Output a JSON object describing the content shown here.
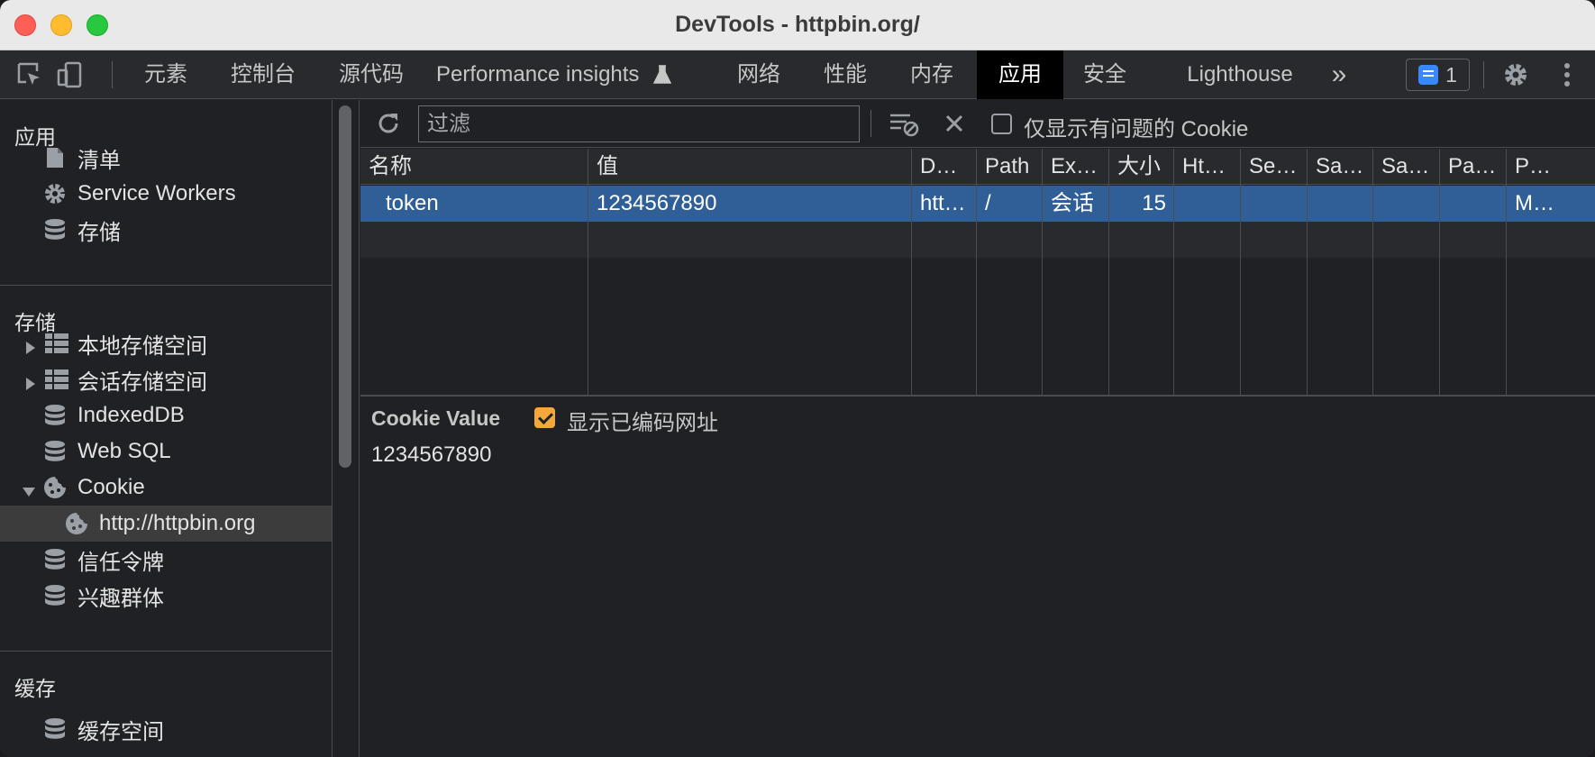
{
  "window": {
    "title": "DevTools - httpbin.org/"
  },
  "tabs": [
    {
      "label": "元素"
    },
    {
      "label": "控制台"
    },
    {
      "label": "源代码"
    },
    {
      "label": "Performance insights"
    },
    {
      "label": "网络"
    },
    {
      "label": "性能"
    },
    {
      "label": "内存"
    },
    {
      "label": "应用"
    },
    {
      "label": "安全"
    },
    {
      "label": "Lighthouse"
    }
  ],
  "active_tab": "应用",
  "more_tabs_glyph": "»",
  "issues": {
    "count": "1"
  },
  "sidebar": {
    "sections": [
      {
        "heading": "应用",
        "items": [
          {
            "label": "清单",
            "icon": "file-icon"
          },
          {
            "label": "Service Workers",
            "icon": "gear-icon"
          },
          {
            "label": "存储",
            "icon": "database-icon"
          }
        ]
      },
      {
        "heading": "存储",
        "items": [
          {
            "label": "本地存储空间",
            "icon": "grid-icon"
          },
          {
            "label": "会话存储空间",
            "icon": "grid-icon"
          },
          {
            "label": "IndexedDB",
            "icon": "database-icon"
          },
          {
            "label": "Web SQL",
            "icon": "database-icon"
          },
          {
            "label": "Cookie",
            "icon": "cookie-icon"
          },
          {
            "label": "http://httpbin.org",
            "icon": "cookie-icon",
            "selected": true
          },
          {
            "label": "信任令牌",
            "icon": "database-icon"
          },
          {
            "label": "兴趣群体",
            "icon": "database-icon"
          }
        ]
      },
      {
        "heading": "缓存",
        "items": [
          {
            "label": "缓存空间",
            "icon": "database-icon"
          }
        ]
      }
    ]
  },
  "toolbar": {
    "filter_placeholder": "过滤",
    "only_issues_label": "仅显示有问题的 Cookie"
  },
  "table": {
    "columns": [
      "名称",
      "值",
      "D…",
      "Path",
      "Ex…",
      "大小",
      "Ht…",
      "Se…",
      "Sa…",
      "Sa…",
      "Pa…",
      "P…"
    ],
    "rows": [
      [
        "token",
        "1234567890",
        "htt…",
        "/",
        "会话",
        "15",
        "",
        "",
        "",
        "",
        "",
        "M…"
      ]
    ]
  },
  "cookie_value": {
    "label": "Cookie Value",
    "show_decoded_label": "显示已编码网址",
    "show_decoded_checked": true,
    "value": "1234567890"
  },
  "colors": {
    "selected_row": "#2f5f96",
    "active_tab_bg": "#000000",
    "accent_checkbox": "#f4a73c",
    "issues_icon": "#3a88ff"
  }
}
